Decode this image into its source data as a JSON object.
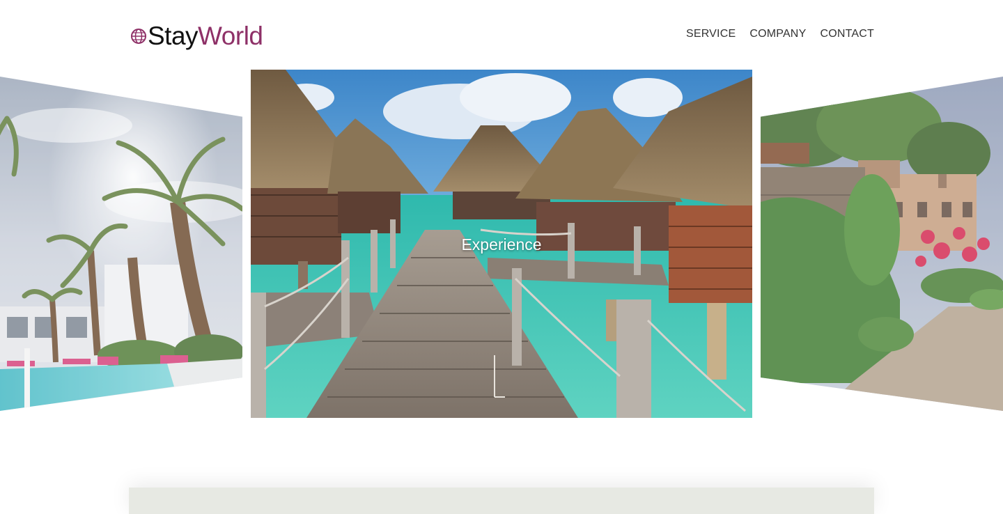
{
  "header": {
    "brand_first": "Stay",
    "brand_second": "World",
    "brand_color": "#8e3067",
    "logo_icon": "globe-icon",
    "nav": [
      {
        "label": "SERVICE"
      },
      {
        "label": "COMPANY"
      },
      {
        "label": "CONTACT"
      }
    ]
  },
  "carousel": {
    "active_caption": "Experience",
    "slides": [
      {
        "scene": "pool-with-palm-trees"
      },
      {
        "scene": "overwater-bungalows-boardwalk"
      },
      {
        "scene": "stone-villa-with-flowers"
      }
    ]
  },
  "colors": {
    "accent": "#8e3067",
    "nav_text": "#333333",
    "panel": "#e7e9e3"
  }
}
